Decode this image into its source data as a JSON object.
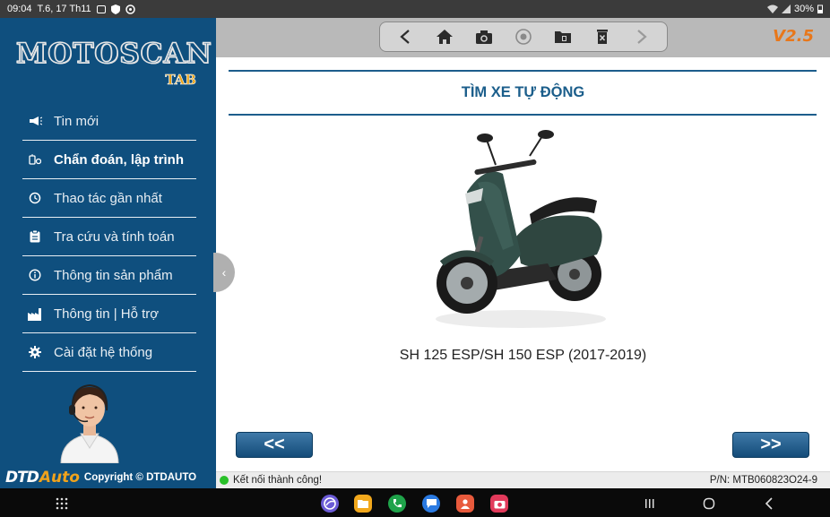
{
  "status_bar": {
    "time": "09:04",
    "date": "T.6, 17 Th11",
    "battery": "30%"
  },
  "sidebar": {
    "logo_main": "MOTOSCAN",
    "logo_sub": "TAB",
    "items": [
      {
        "label": "Tin mới",
        "icon": "megaphone-icon"
      },
      {
        "label": "Chẩn đoán, lập trình",
        "icon": "diagnostic-icon",
        "active": true
      },
      {
        "label": "Thao tác gần nhất",
        "icon": "history-icon"
      },
      {
        "label": "Tra cứu và tính toán",
        "icon": "clipboard-icon"
      },
      {
        "label": "Thông tin sản phẩm",
        "icon": "info-icon"
      },
      {
        "label": "Thông tin | Hỗ trợ",
        "icon": "factory-icon"
      },
      {
        "label": "Cài đặt hệ thống",
        "icon": "gear-icon"
      }
    ],
    "brand_dtd": "DTD",
    "brand_auto": "Auto",
    "copyright": "Copyright © DTDAUTO"
  },
  "toolbar": {
    "icons": [
      "back-icon",
      "home-icon",
      "camera-icon",
      "record-icon",
      "folder-icon",
      "delete-icon",
      "forward-icon"
    ],
    "version": "V2.5"
  },
  "main": {
    "title": "TÌM XE TỰ ĐỘNG",
    "model_name": "SH 125 ESP/SH 150 ESP (2017-2019)",
    "prev_label": "<<",
    "next_label": ">>",
    "collapse_label": "‹"
  },
  "connection": {
    "status": "Kết nối thành công!",
    "part_number": "P/N: MTB060823O24-9"
  },
  "colors": {
    "sidebar_bg": "#0f4f7e",
    "accent": "#1b5e8b",
    "version": "#e8771a",
    "connected": "#29c029"
  }
}
